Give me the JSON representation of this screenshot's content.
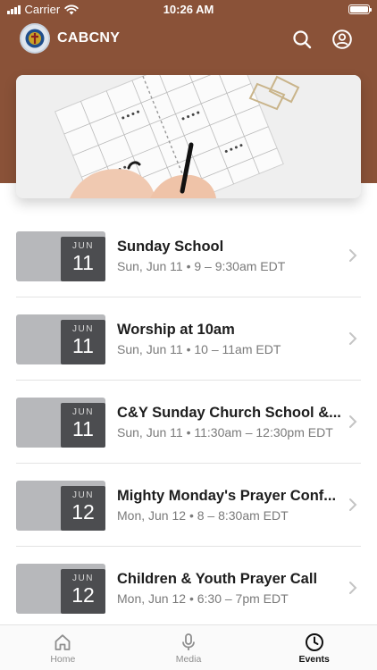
{
  "status_bar": {
    "carrier": "Carrier",
    "time": "10:26 AM"
  },
  "header": {
    "title": "CABCNY",
    "search_icon": "search-icon",
    "profile_icon": "profile-icon"
  },
  "hero": {
    "image": "planner-calendar-photo"
  },
  "events": [
    {
      "month": "JUN",
      "day": "11",
      "title": "Sunday School",
      "time": "Sun, Jun 11 • 9 – 9:30am EDT"
    },
    {
      "month": "JUN",
      "day": "11",
      "title": "Worship at 10am",
      "time": "Sun, Jun 11 • 10 – 11am EDT"
    },
    {
      "month": "JUN",
      "day": "11",
      "title": "C&Y Sunday Church School  &...",
      "time": "Sun, Jun 11 • 11:30am – 12:30pm EDT"
    },
    {
      "month": "JUN",
      "day": "12",
      "title": "Mighty Monday's Prayer Conf...",
      "time": "Mon, Jun 12 • 8 – 8:30am EDT"
    },
    {
      "month": "JUN",
      "day": "12",
      "title": "Children & Youth Prayer Call",
      "time": "Mon, Jun 12 • 6:30 – 7pm EDT"
    }
  ],
  "tabs": [
    {
      "label": "Home",
      "icon": "home-icon",
      "active": false
    },
    {
      "label": "Media",
      "icon": "microphone-icon",
      "active": false
    },
    {
      "label": "Events",
      "icon": "clock-icon",
      "active": true
    }
  ],
  "colors": {
    "header_brown": "#8a5238",
    "date_block": "#4c4d50",
    "thumb_gray": "#b7b8bb"
  }
}
